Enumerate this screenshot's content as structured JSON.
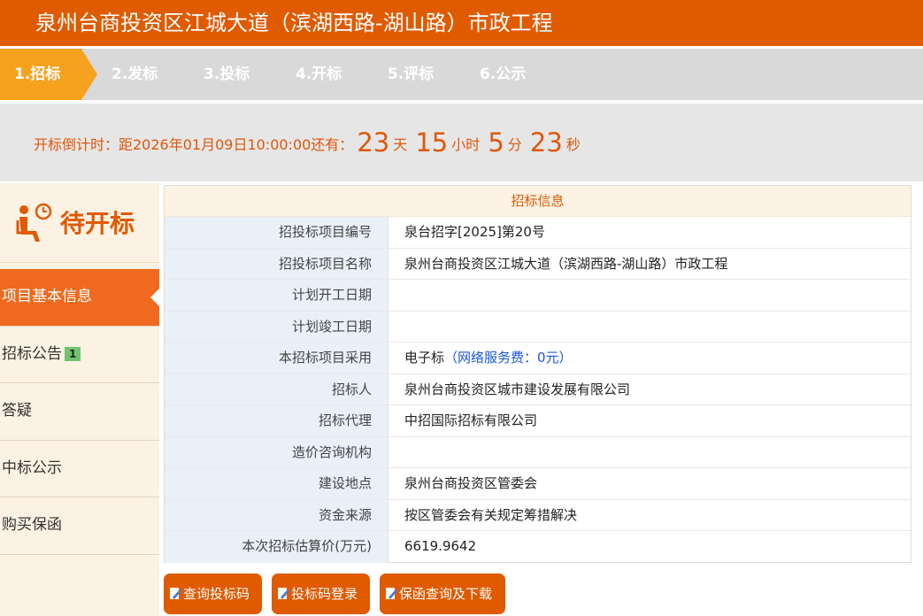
{
  "header": {
    "title": "泉州台商投资区江城大道（滨湖西路-湖山路）市政工程"
  },
  "steps": [
    {
      "label": "1.招标",
      "active": true
    },
    {
      "label": "2.发标",
      "active": false
    },
    {
      "label": "3.投标",
      "active": false
    },
    {
      "label": "4.开标",
      "active": false
    },
    {
      "label": "5.评标",
      "active": false
    },
    {
      "label": "6.公示",
      "active": false
    }
  ],
  "countdown": {
    "prefix": "开标倒计时：距2026年01月09日10:00:00还有：",
    "days": "23",
    "days_unit": "天",
    "hours": "15",
    "hours_unit": "小时",
    "minutes": "5",
    "minutes_unit": "分",
    "seconds": "23",
    "seconds_unit": "秒"
  },
  "sidebar": {
    "status": "待开标",
    "items": [
      {
        "label": "项目基本信息",
        "active": true
      },
      {
        "label": "招标公告",
        "badge": "1"
      },
      {
        "label": "答疑"
      },
      {
        "label": "中标公示"
      },
      {
        "label": "购买保函"
      }
    ]
  },
  "panel": {
    "title": "招标信息",
    "rows": [
      {
        "label": "招投标项目编号",
        "value": "泉台招字[2025]第20号"
      },
      {
        "label": "招投标项目名称",
        "value": "泉州台商投资区江城大道（滨湖西路-湖山路）市政工程"
      },
      {
        "label": "计划开工日期",
        "value": ""
      },
      {
        "label": "计划竣工日期",
        "value": ""
      },
      {
        "label": "本招标项目采用",
        "value": "电子标",
        "note": "（网络服务费：0元）"
      },
      {
        "label": "招标人",
        "value": "泉州台商投资区城市建设发展有限公司"
      },
      {
        "label": "招标代理",
        "value": "中招国际招标有限公司"
      },
      {
        "label": "造价咨询机构",
        "value": ""
      },
      {
        "label": "建设地点",
        "value": "泉州台商投资区管委会"
      },
      {
        "label": "资金来源",
        "value": "按区管委会有关规定筹措解决"
      },
      {
        "label": "本次招标估算价(万元)",
        "value": "6619.9642"
      }
    ]
  },
  "buttons": {
    "query_code": "查询投标码",
    "login_code": "投标码登录",
    "guarantee": "保函查询及下载"
  },
  "colors": {
    "brand": "#e05a00",
    "step_active": "#f6a21f",
    "sidebar_active": "#ef6a1f"
  },
  "icons": {
    "status": "waiting-person-clock-icon",
    "buttons": "edit-document-icon"
  }
}
